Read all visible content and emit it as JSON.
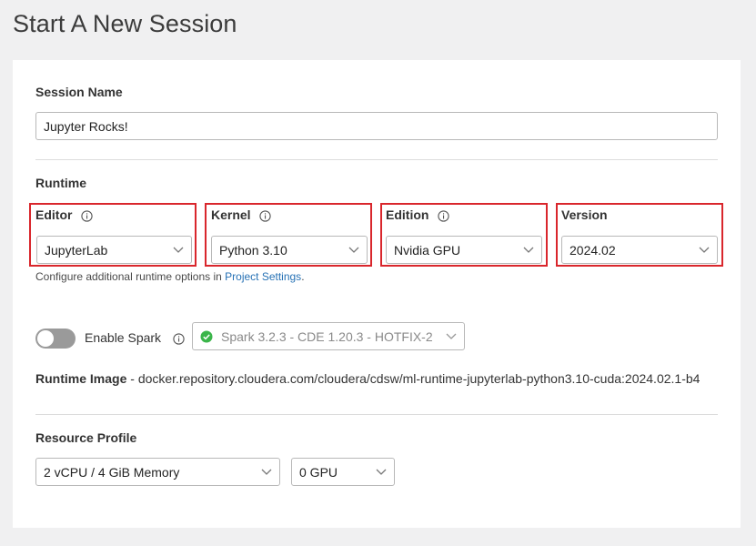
{
  "page": {
    "title": "Start A New Session"
  },
  "session": {
    "name_label": "Session Name",
    "name_value": "Jupyter Rocks!"
  },
  "runtime": {
    "section_label": "Runtime",
    "editor": {
      "label": "Editor",
      "value": "JupyterLab"
    },
    "kernel": {
      "label": "Kernel",
      "value": "Python 3.10"
    },
    "edition": {
      "label": "Edition",
      "value": "Nvidia GPU"
    },
    "version": {
      "label": "Version",
      "value": "2024.02"
    },
    "configure_text": "Configure additional runtime options in",
    "configure_link": "Project Settings",
    "configure_suffix": "."
  },
  "spark": {
    "toggle_label": "Enable Spark",
    "select_value": "Spark 3.2.3 - CDE 1.20.3 - HOTFIX-2",
    "enabled": false
  },
  "runtime_image": {
    "label": "Runtime Image",
    "separator": " - ",
    "value": "docker.repository.cloudera.com/cloudera/cdsw/ml-runtime-jupyterlab-python3.10-cuda:2024.02.1-b4"
  },
  "resource_profile": {
    "label": "Resource Profile",
    "cpu_memory": "2 vCPU / 4 GiB Memory",
    "gpu": "0 GPU"
  },
  "colors": {
    "highlight": "#d9262c",
    "link": "#2671b5",
    "spark_check": "#3bb54a"
  }
}
